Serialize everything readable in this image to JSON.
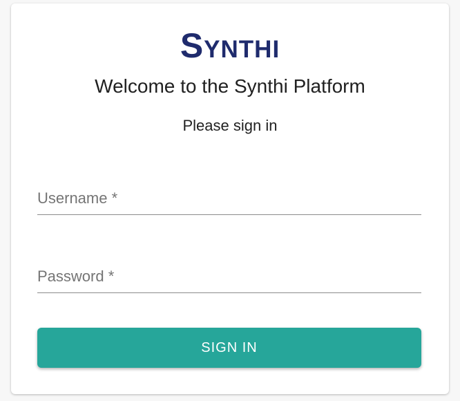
{
  "logo": "Synthi",
  "title": "Welcome to the Synthi Platform",
  "subtitle": "Please sign in",
  "form": {
    "username_label": "Username *",
    "username_value": "",
    "password_label": "Password *",
    "password_value": "",
    "submit_label": "SIGN IN"
  },
  "colors": {
    "brand": "#1f2b6d",
    "accent": "#26a69a"
  }
}
